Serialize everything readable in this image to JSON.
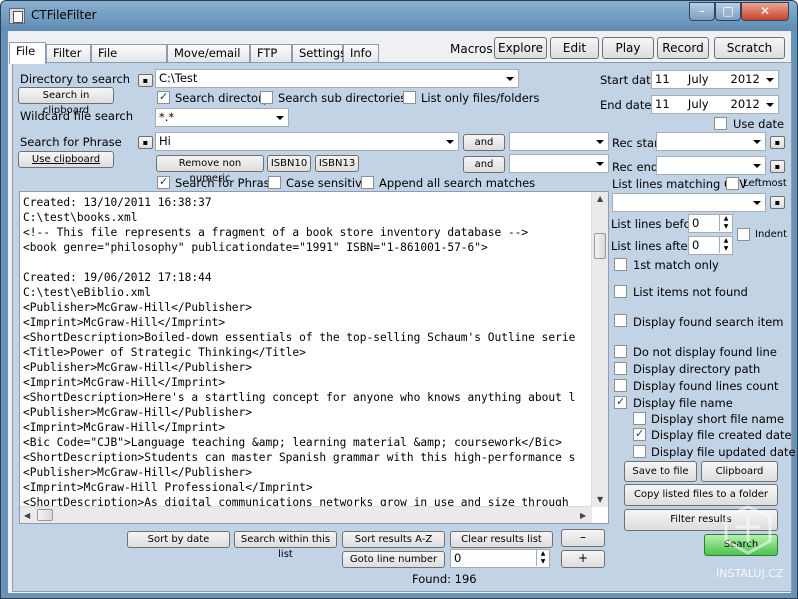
{
  "window": {
    "title": "CTFileFilter",
    "minimize": "–",
    "maximize": "□",
    "close": "✕"
  },
  "tabs": [
    "File",
    "Filter",
    "File renaming",
    "Move/email file",
    "FTP",
    "Settings",
    "Info"
  ],
  "macros": {
    "label": "Macros:",
    "buttons": [
      "Explore",
      "Edit",
      "Play",
      "Record",
      "Scratch Pad"
    ]
  },
  "directory": {
    "label": "Directory to search",
    "value": "C:\\Test",
    "clipboard_button": "Search in clipboard",
    "search_directory": "Search directory",
    "search_sub": "Search sub directories",
    "list_only": "List only files/folders"
  },
  "wildcard": {
    "label": "Wildcard file search",
    "value": "*.*"
  },
  "phrase": {
    "label": "Search for Phrase",
    "value": "Hi",
    "use_clipboard": "Use clipboard",
    "remove_non_numeric": "Remove non numeric",
    "isbn10": "ISBN10",
    "isbn13": "ISBN13",
    "and1": "and",
    "and2": "and",
    "search_for_phrase": "Search for Phrase",
    "case_sensitive": "Case sensitive",
    "append_all": "Append all search matches"
  },
  "dates": {
    "start_label": "Start date",
    "start_day": "11",
    "start_month": "July",
    "start_year": "2012",
    "end_label": "End date",
    "end_day": "11",
    "end_month": "July",
    "end_year": "2012",
    "use_date": "Use date"
  },
  "rec": {
    "start_label": "Rec start",
    "end_label": "Rec end"
  },
  "csv": {
    "label": "List lines matching CSV",
    "leftmost": "Leftmost"
  },
  "options": {
    "lines_before_label": "List lines before",
    "lines_before": "0",
    "lines_after_label": "List lines after",
    "lines_after": "0",
    "indent": "Indent",
    "first_match": "1st match only",
    "list_not_found": "List items not found",
    "display_found_item": "Display found search item",
    "not_display_found": "Do not display found line",
    "display_dir": "Display directory path",
    "display_count": "Display found lines count",
    "display_file_name": "Display file name",
    "display_short": "Display short file name",
    "display_created": "Display file created date",
    "display_updated": "Display file updated date"
  },
  "actions": {
    "save_to_file": "Save to file",
    "clipboard": "Clipboard",
    "copy_listed": "Copy listed files to a folder",
    "filter_results": "Filter results",
    "search": "Search"
  },
  "bottom": {
    "sort_by_date": "Sort by date",
    "search_within": "Search within this list",
    "sort_az": "Sort results A-Z",
    "clear": "Clear results list",
    "goto_line": "Goto line number",
    "goto_value": "0",
    "minus": "–",
    "plus": "+",
    "found": "Found:  196"
  },
  "results_lines": [
    "Created: 13/10/2011 16:38:37",
    "C:\\test\\books.xml",
    "<!-- This file represents a fragment of a book store inventory database -->",
    "<book genre=\"philosophy\" publicationdate=\"1991\" ISBN=\"1-861001-57-6\">",
    "",
    "Created: 19/06/2012 17:18:44",
    "C:\\test\\eBiblio.xml",
    "<Publisher>McGraw-Hill</Publisher>",
    "<Imprint>McGraw-Hill</Imprint>",
    "<ShortDescription>Boiled-down essentials of the top-selling Schaum's Outline serie",
    "<Title>Power of Strategic Thinking</Title>",
    "<Publisher>McGraw-Hill</Publisher>",
    "<Imprint>McGraw-Hill</Imprint>",
    "<ShortDescription>Here's a startling concept for anyone who knows anything about l",
    "<Publisher>McGraw-Hill</Publisher>",
    "<Imprint>McGraw-Hill</Imprint>",
    "<Bic Code=\"CJB\">Language teaching &amp; learning material &amp; coursework</Bic>",
    "<ShortDescription>Students can master Spanish grammar with this high-performance s",
    "<Publisher>McGraw-Hill</Publisher>",
    "<Imprint>McGraw-Hill Professional</Imprint>",
    "<ShortDescription>As digital communications networks grow in use and size through"
  ],
  "watermark": "INSTALUJ.CZ"
}
